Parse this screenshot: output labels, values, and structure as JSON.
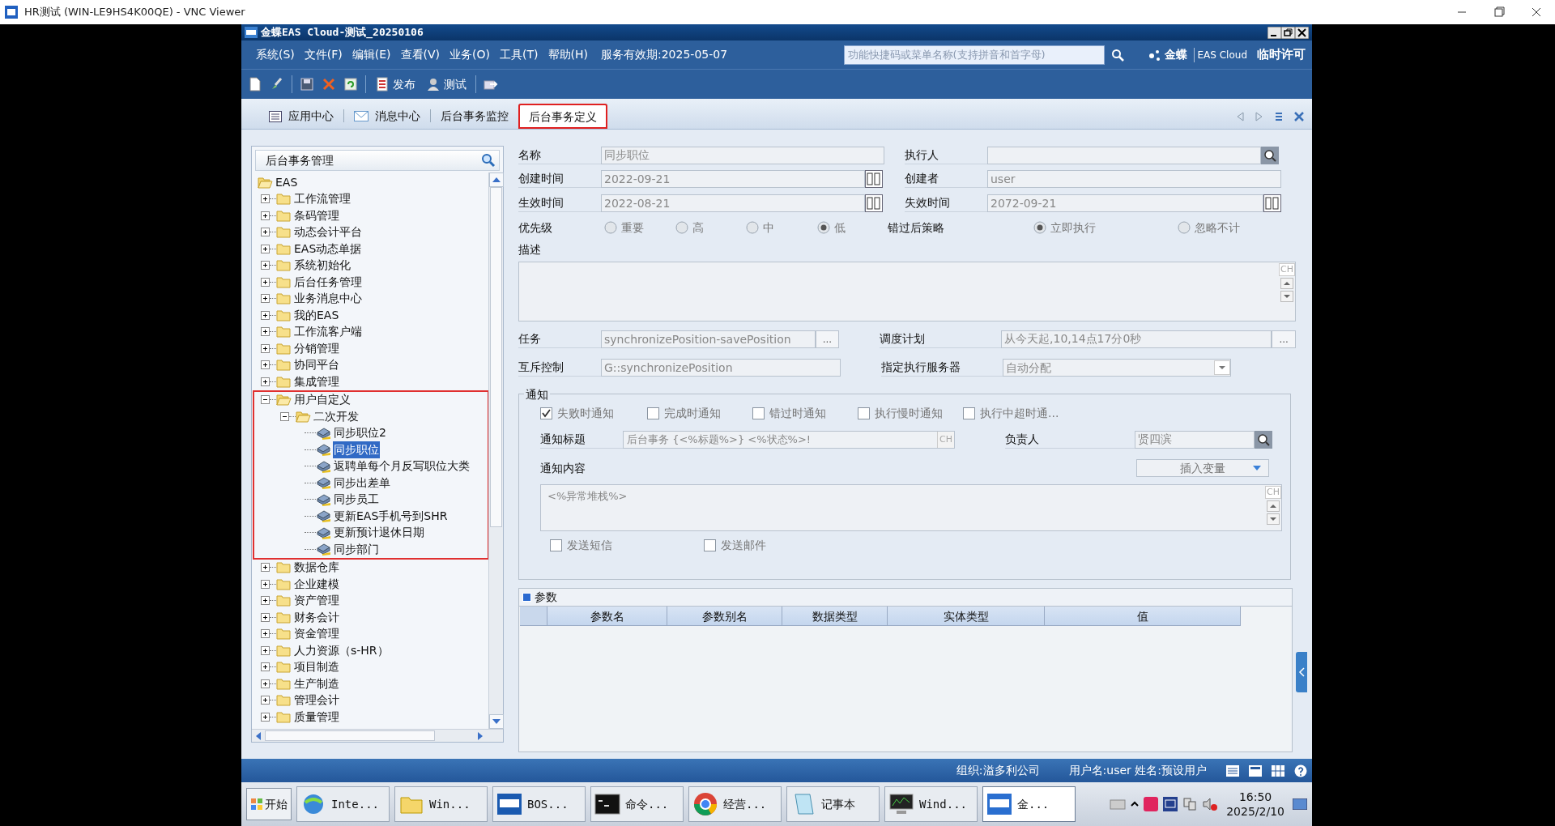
{
  "viewer": {
    "title": "HR测试 (WIN-LE9HS4K00QE) - VNC Viewer"
  },
  "app": {
    "title": "金蝶EAS Cloud-测试_20250106"
  },
  "menu": [
    "系统(S)",
    "文件(F)",
    "编辑(E)",
    "查看(V)",
    "业务(O)",
    "工具(T)",
    "帮助(H)"
  ],
  "service_expiry": "服务有效期:2025-05-07",
  "search": {
    "placeholder": "功能快捷码或菜单名称(支持拼音和首字母)"
  },
  "brand": {
    "name": "金蝶",
    "product": "EAS Cloud",
    "license": "临时许可"
  },
  "toolbar": [
    {
      "kind": "new"
    },
    {
      "kind": "edit"
    },
    {
      "kind": "sep"
    },
    {
      "kind": "save"
    },
    {
      "kind": "delete"
    },
    {
      "kind": "refresh"
    },
    {
      "kind": "sep"
    },
    {
      "kind": "publish",
      "label": "发布"
    },
    {
      "kind": "test",
      "label": "测试"
    },
    {
      "kind": "sep"
    },
    {
      "kind": "export"
    }
  ],
  "tabs": [
    {
      "label": "应用中心",
      "kind": "app",
      "selected": false,
      "highlighted": false
    },
    {
      "label": "消息中心",
      "kind": "mail",
      "selected": false,
      "highlighted": false
    },
    {
      "label": "后台事务监控",
      "kind": "plain",
      "selected": false,
      "highlighted": false
    },
    {
      "label": "后台事务定义",
      "kind": "plain",
      "selected": true,
      "highlighted": true
    }
  ],
  "tree": {
    "title": "后台事务管理",
    "items": [
      {
        "label": "EAS",
        "kind": "folder",
        "expanded": true,
        "selected": false,
        "children": [
          {
            "label": "工作流管理",
            "kind": "folder",
            "expanded": false,
            "selected": false
          },
          {
            "label": "条码管理",
            "kind": "folder",
            "expanded": false,
            "selected": false
          },
          {
            "label": "动态会计平台",
            "kind": "folder",
            "expanded": false,
            "selected": false
          },
          {
            "label": "EAS动态单据",
            "kind": "folder",
            "expanded": false,
            "selected": false
          },
          {
            "label": "系统初始化",
            "kind": "folder",
            "expanded": false,
            "selected": false
          },
          {
            "label": "后台任务管理",
            "kind": "folder",
            "expanded": false,
            "selected": false
          },
          {
            "label": "业务消息中心",
            "kind": "folder",
            "expanded": false,
            "selected": false
          },
          {
            "label": "我的EAS",
            "kind": "folder",
            "expanded": false,
            "selected": false
          },
          {
            "label": "工作流客户端",
            "kind": "folder",
            "expanded": false,
            "selected": false
          },
          {
            "label": "分销管理",
            "kind": "folder",
            "expanded": false,
            "selected": false
          },
          {
            "label": "协同平台",
            "kind": "folder",
            "expanded": false,
            "selected": false
          },
          {
            "label": "集成管理",
            "kind": "folder",
            "expanded": false,
            "selected": false
          },
          {
            "label": "用户自定义",
            "kind": "folder",
            "expanded": true,
            "selected": false,
            "highlighted": true,
            "children": [
              {
                "label": "二次开发",
                "kind": "folder",
                "expanded": true,
                "selected": false,
                "children": [
                  {
                    "label": "同步职位2",
                    "kind": "task",
                    "selected": false
                  },
                  {
                    "label": "同步职位",
                    "kind": "task",
                    "selected": true
                  },
                  {
                    "label": "返聘单每个月反写职位大类",
                    "kind": "task",
                    "selected": false
                  },
                  {
                    "label": "同步出差单",
                    "kind": "task",
                    "selected": false
                  },
                  {
                    "label": "同步员工",
                    "kind": "task",
                    "selected": false
                  },
                  {
                    "label": "更新EAS手机号到SHR",
                    "kind": "task",
                    "selected": false
                  },
                  {
                    "label": "更新预计退休日期",
                    "kind": "task",
                    "selected": false
                  },
                  {
                    "label": "同步部门",
                    "kind": "task",
                    "selected": false
                  }
                ]
              }
            ]
          },
          {
            "label": "数据仓库",
            "kind": "folder",
            "expanded": false,
            "selected": false
          },
          {
            "label": "企业建模",
            "kind": "folder",
            "expanded": false,
            "selected": false
          },
          {
            "label": "资产管理",
            "kind": "folder",
            "expanded": false,
            "selected": false
          },
          {
            "label": "财务会计",
            "kind": "folder",
            "expanded": false,
            "selected": false
          },
          {
            "label": "资金管理",
            "kind": "folder",
            "expanded": false,
            "selected": false
          },
          {
            "label": "人力资源（s-HR）",
            "kind": "folder",
            "expanded": false,
            "selected": false
          },
          {
            "label": "项目制造",
            "kind": "folder",
            "expanded": false,
            "selected": false
          },
          {
            "label": "生产制造",
            "kind": "folder",
            "expanded": false,
            "selected": false
          },
          {
            "label": "管理会计",
            "kind": "folder",
            "expanded": false,
            "selected": false
          },
          {
            "label": "质量管理",
            "kind": "folder",
            "expanded": false,
            "selected": false
          }
        ]
      }
    ]
  },
  "form": {
    "name": {
      "label": "名称",
      "value": "同步职位"
    },
    "executor": {
      "label": "执行人"
    },
    "created": {
      "label": "创建时间",
      "value": "2022-09-21"
    },
    "creator": {
      "label": "创建者",
      "value": "user"
    },
    "effective": {
      "label": "生效时间",
      "value": "2022-08-21"
    },
    "expiry": {
      "label": "失效时间",
      "value": "2072-09-21"
    },
    "priority": {
      "label": "优先级",
      "options": [
        {
          "label": "重要",
          "selected": false
        },
        {
          "label": "高",
          "selected": false
        },
        {
          "label": "中",
          "selected": false
        },
        {
          "label": "低",
          "selected": true
        }
      ]
    },
    "missed_policy": {
      "label": "错过后策略",
      "options": [
        {
          "label": "立即执行",
          "selected": true
        },
        {
          "label": "忽略不计",
          "selected": false
        }
      ]
    },
    "description": {
      "label": "描述",
      "input_mode": "CH"
    },
    "task": {
      "label": "任务",
      "value": "synchronizePosition-savePosition",
      "browse": "..."
    },
    "schedule": {
      "label": "调度计划",
      "value": "从今天起,10,14点17分0秒",
      "browse": "..."
    },
    "mutex": {
      "label": "互斥控制",
      "value": "G::synchronizePosition"
    },
    "server": {
      "label": "指定执行服务器",
      "value": "自动分配"
    }
  },
  "notification": {
    "title": "通知",
    "events": [
      {
        "label": "失败时通知",
        "checked": true
      },
      {
        "label": "完成时通知",
        "checked": false
      },
      {
        "label": "错过时通知",
        "checked": false
      },
      {
        "label": "执行慢时通知",
        "checked": false
      },
      {
        "label": "执行中超时通...",
        "checked": false
      }
    ],
    "subject": {
      "label": "通知标题",
      "value": "后台事务 {<%标题%>} <%状态%>!",
      "input_mode": "CH"
    },
    "owner": {
      "label": "负责人",
      "value": "贤四滨"
    },
    "content": {
      "label": "通知内容",
      "value": "<%异常堆栈%>",
      "input_mode": "CH"
    },
    "insert_variable": "插入变量",
    "channels": [
      {
        "label": "发送短信",
        "checked": false
      },
      {
        "label": "发送邮件",
        "checked": false
      }
    ]
  },
  "params": {
    "title": "参数",
    "columns": [
      "参数名",
      "参数别名",
      "数据类型",
      "实体类型",
      "值"
    ]
  },
  "status_bar": {
    "org": "组织:溢多利公司",
    "user": "用户名:user 姓名:预设用户"
  },
  "taskbar": {
    "start": "开始",
    "items": [
      {
        "kind": "ie",
        "label": "Inte...",
        "selected": false
      },
      {
        "kind": "folder",
        "label": "Win...",
        "selected": false
      },
      {
        "kind": "bos",
        "label": "BOS...",
        "selected": false
      },
      {
        "kind": "cmd",
        "label": "命令...",
        "selected": false
      },
      {
        "kind": "chrome",
        "label": "经营...",
        "selected": false
      },
      {
        "kind": "notepad",
        "label": "记事本",
        "selected": false
      },
      {
        "kind": "monitor",
        "label": "Wind...",
        "selected": false
      },
      {
        "kind": "eas",
        "label": "金...",
        "selected": true
      }
    ],
    "time": "16:50",
    "date": "2025/2/10"
  }
}
